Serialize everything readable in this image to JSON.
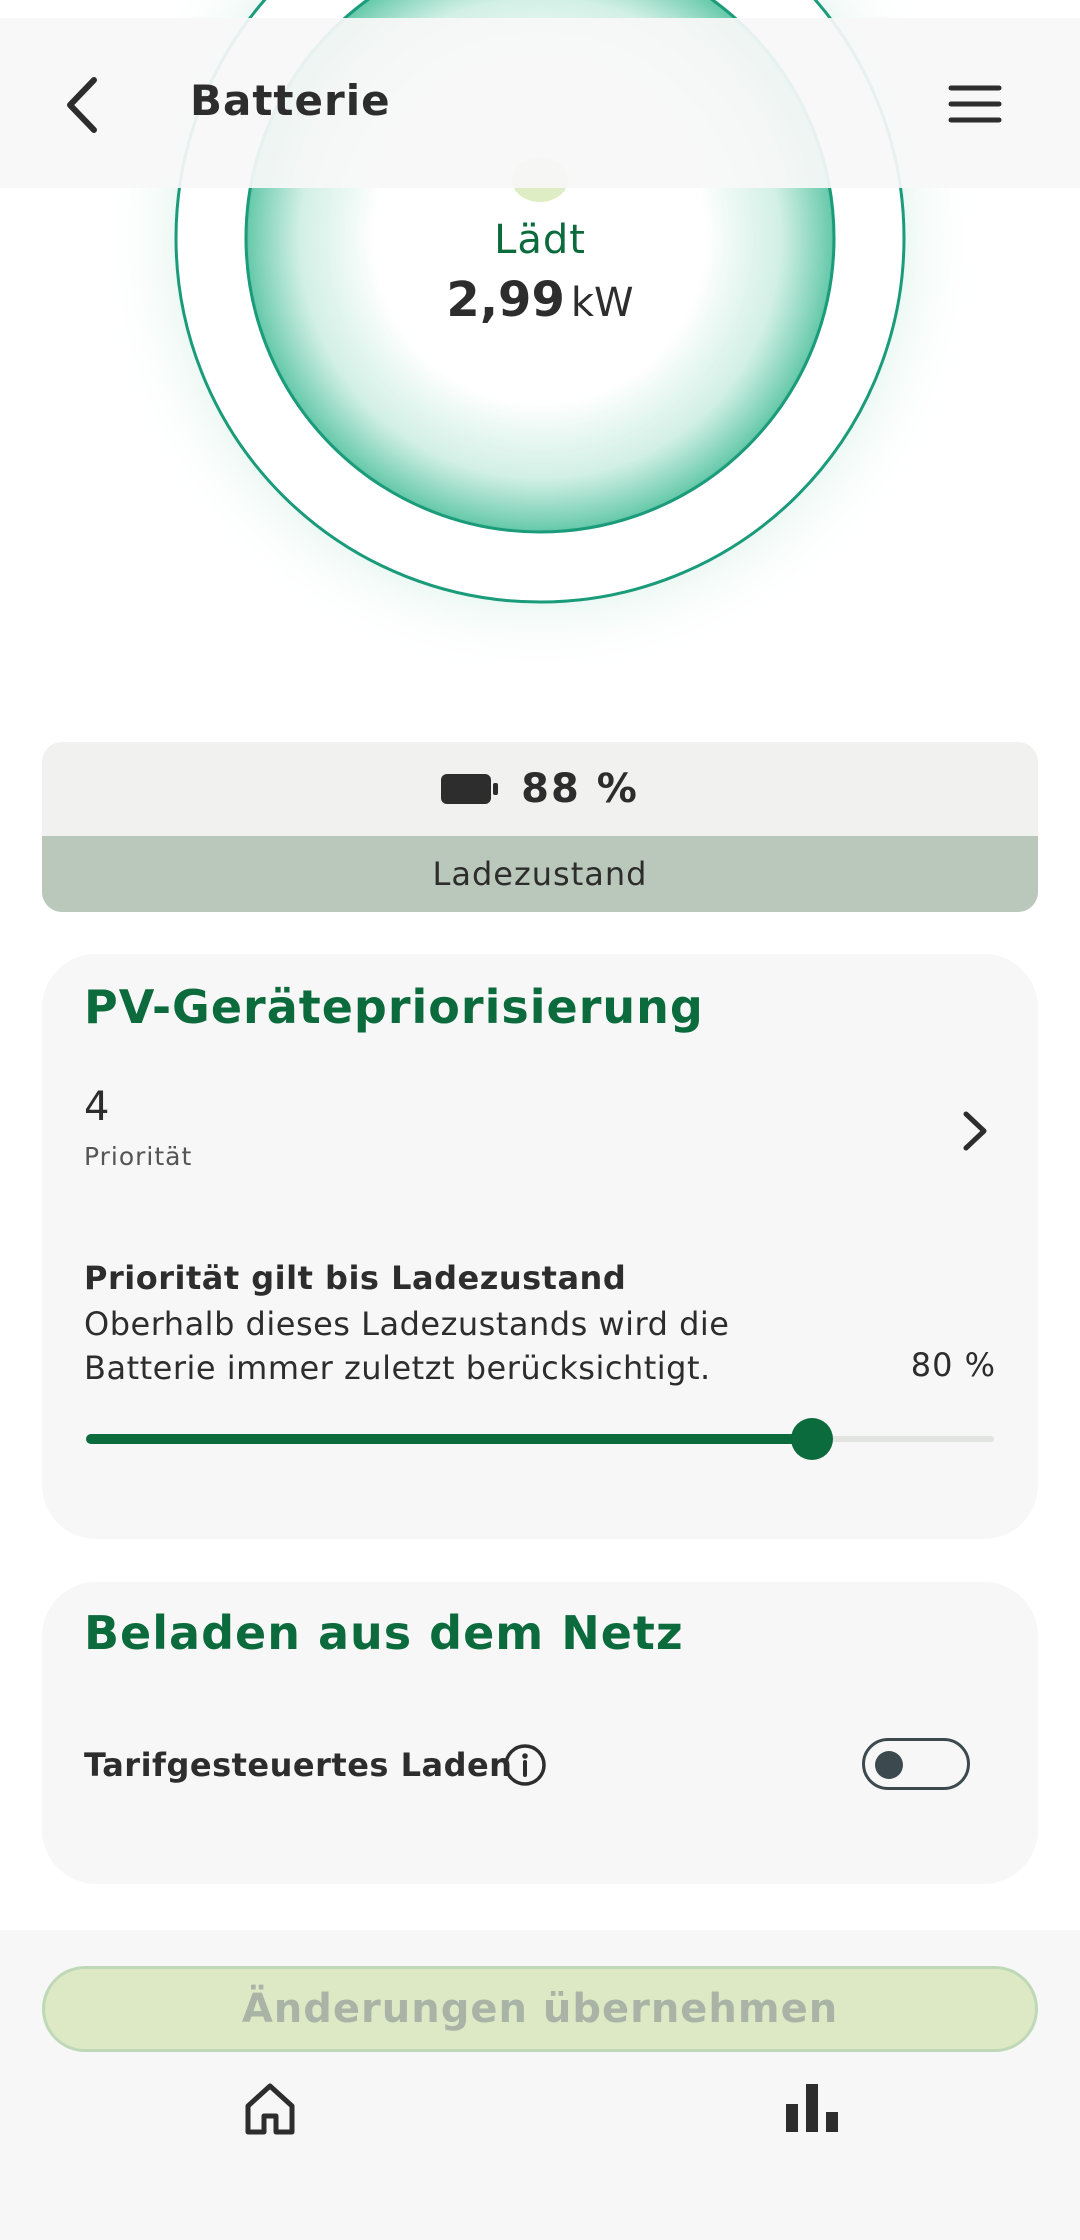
{
  "header": {
    "title": "Batterie",
    "back_icon": "chevron-left-icon",
    "menu_icon": "hamburger-menu-icon"
  },
  "gauge": {
    "status": "Lädt",
    "power_value": "2,99",
    "power_unit": "kW"
  },
  "state_of_charge": {
    "value": "88 %",
    "label": "Ladezustand",
    "icon": "battery-icon"
  },
  "pv_priority": {
    "title": "PV-Gerätepriorisierung",
    "priority_value": "4",
    "priority_label": "Priorität",
    "soc_limit_title": "Priorität gilt bis Ladezustand",
    "soc_limit_description": "Oberhalb dieses Ladezustands wird die Batterie immer zuletzt berücksichtigt.",
    "slider_value_text": "80 %",
    "slider_fraction": 0.8
  },
  "grid_charging": {
    "title": "Beladen aus dem Netz",
    "tariff_label": "Tarifgesteuertes Laden",
    "tariff_enabled": false
  },
  "actions": {
    "apply_label": "Änderungen übernehmen"
  },
  "bottom_nav": {
    "home_icon": "home-icon",
    "stats_icon": "bar-chart-icon"
  },
  "colors": {
    "brand_green": "#0b6b3c",
    "ring_teal": "#1fa583",
    "soc_bar": "#b9c8ba",
    "apply_disabled_bg": "#dde9c5"
  }
}
